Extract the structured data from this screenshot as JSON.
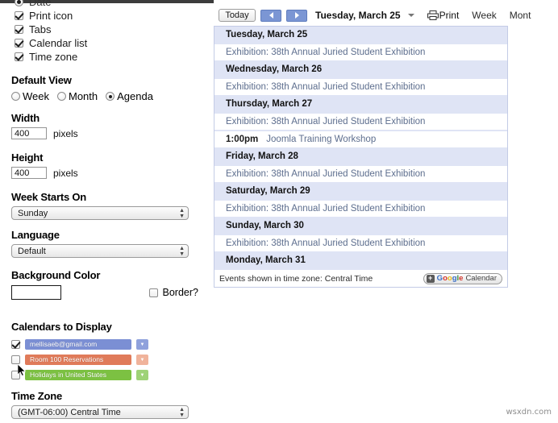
{
  "settings": {
    "clipped_item": {
      "label": "Date",
      "checked": true
    },
    "display_options": [
      {
        "label": "Print icon",
        "checked": true
      },
      {
        "label": "Tabs",
        "checked": true
      },
      {
        "label": "Calendar list",
        "checked": true
      },
      {
        "label": "Time zone",
        "checked": true
      }
    ],
    "default_view": {
      "title": "Default View",
      "options": [
        {
          "label": "Week",
          "selected": false
        },
        {
          "label": "Month",
          "selected": false
        },
        {
          "label": "Agenda",
          "selected": true
        }
      ]
    },
    "width": {
      "title": "Width",
      "value": "400",
      "unit": "pixels"
    },
    "height": {
      "title": "Height",
      "value": "400",
      "unit": "pixels"
    },
    "week_starts_on": {
      "title": "Week Starts On",
      "value": "Sunday"
    },
    "language": {
      "title": "Language",
      "value": "Default"
    },
    "background_color": {
      "title": "Background Color",
      "value": "#ffffff",
      "border_label": "Border?",
      "border_checked": false
    },
    "calendars": {
      "title": "Calendars to Display",
      "items": [
        {
          "label": "mellisaeb@gmail.com",
          "checked": true,
          "color": "#7b8fd4",
          "drop_color": "#8fa1dc"
        },
        {
          "label": "Room 100 Reservations",
          "checked": false,
          "color": "#e07b5a",
          "drop_color": "#f0b39b"
        },
        {
          "label": "Holidays in United States",
          "checked": false,
          "color": "#7cc142",
          "drop_color": "#9ed277"
        }
      ]
    },
    "time_zone": {
      "title": "Time Zone",
      "value": "(GMT-06:00) Central Time"
    }
  },
  "preview": {
    "toolbar": {
      "today_label": "Today",
      "prev_icon": "chevron-left-icon",
      "next_icon": "chevron-right-icon",
      "current_date": "Tuesday, March 25",
      "print_label": "Print",
      "view_week": "Week",
      "view_month": "Mont"
    },
    "agenda": [
      {
        "day": "Tuesday, March 25",
        "events": [
          {
            "time": "",
            "title": "Exhibition: 38th Annual Juried Student Exhibition"
          }
        ]
      },
      {
        "day": "Wednesday, March 26",
        "events": [
          {
            "time": "",
            "title": "Exhibition: 38th Annual Juried Student Exhibition"
          }
        ]
      },
      {
        "day": "Thursday, March 27",
        "events": [
          {
            "time": "",
            "title": "Exhibition: 38th Annual Juried Student Exhibition"
          },
          {
            "time": "1:00pm",
            "title": "Joomla Training Workshop"
          }
        ]
      },
      {
        "day": "Friday, March 28",
        "events": [
          {
            "time": "",
            "title": "Exhibition: 38th Annual Juried Student Exhibition"
          }
        ]
      },
      {
        "day": "Saturday, March 29",
        "events": [
          {
            "time": "",
            "title": "Exhibition: 38th Annual Juried Student Exhibition"
          }
        ]
      },
      {
        "day": "Sunday, March 30",
        "events": [
          {
            "time": "",
            "title": "Exhibition: 38th Annual Juried Student Exhibition"
          }
        ]
      },
      {
        "day": "Monday, March 31",
        "events": []
      }
    ],
    "footer": {
      "timezone_note": "Events shown in time zone: Central Time",
      "badge": {
        "plus": "+",
        "google": "Google",
        "calendar": "Calendar"
      }
    }
  },
  "watermark": "wsxdn.com"
}
